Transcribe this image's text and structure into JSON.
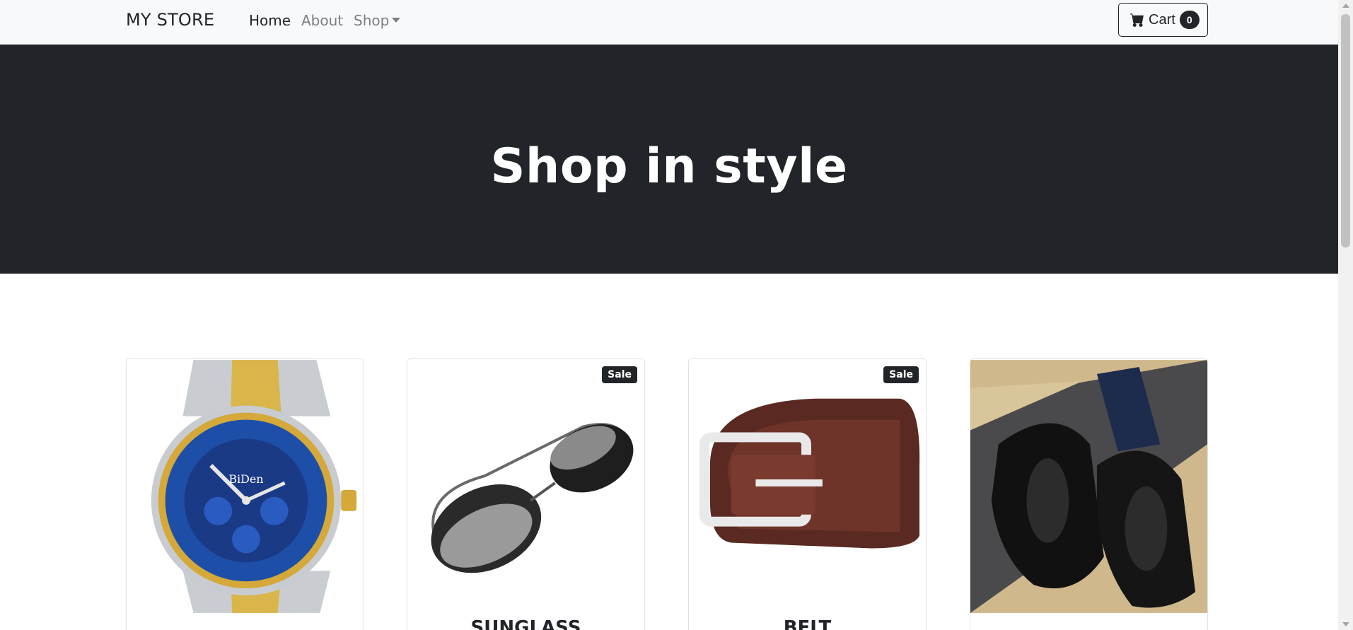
{
  "navbar": {
    "brand": "MY STORE",
    "links": [
      {
        "label": "Home",
        "active": true
      },
      {
        "label": "About",
        "active": false
      },
      {
        "label": "Shop",
        "active": false
      }
    ],
    "cart": {
      "label": "Cart",
      "count": "0",
      "icon": "cart-icon"
    }
  },
  "hero": {
    "title": "Shop in style"
  },
  "products": [
    {
      "name": "",
      "badge": "",
      "image": "watch-image"
    },
    {
      "name": "SUNGLASS",
      "badge": "Sale",
      "image": "sunglasses-image"
    },
    {
      "name": "BELT",
      "badge": "Sale",
      "image": "belt-image"
    },
    {
      "name": "",
      "badge": "",
      "image": "shoes-image"
    }
  ],
  "colors": {
    "dark": "#212529",
    "navbar_bg": "#f8f9fa",
    "muted": "#7a7f85"
  }
}
